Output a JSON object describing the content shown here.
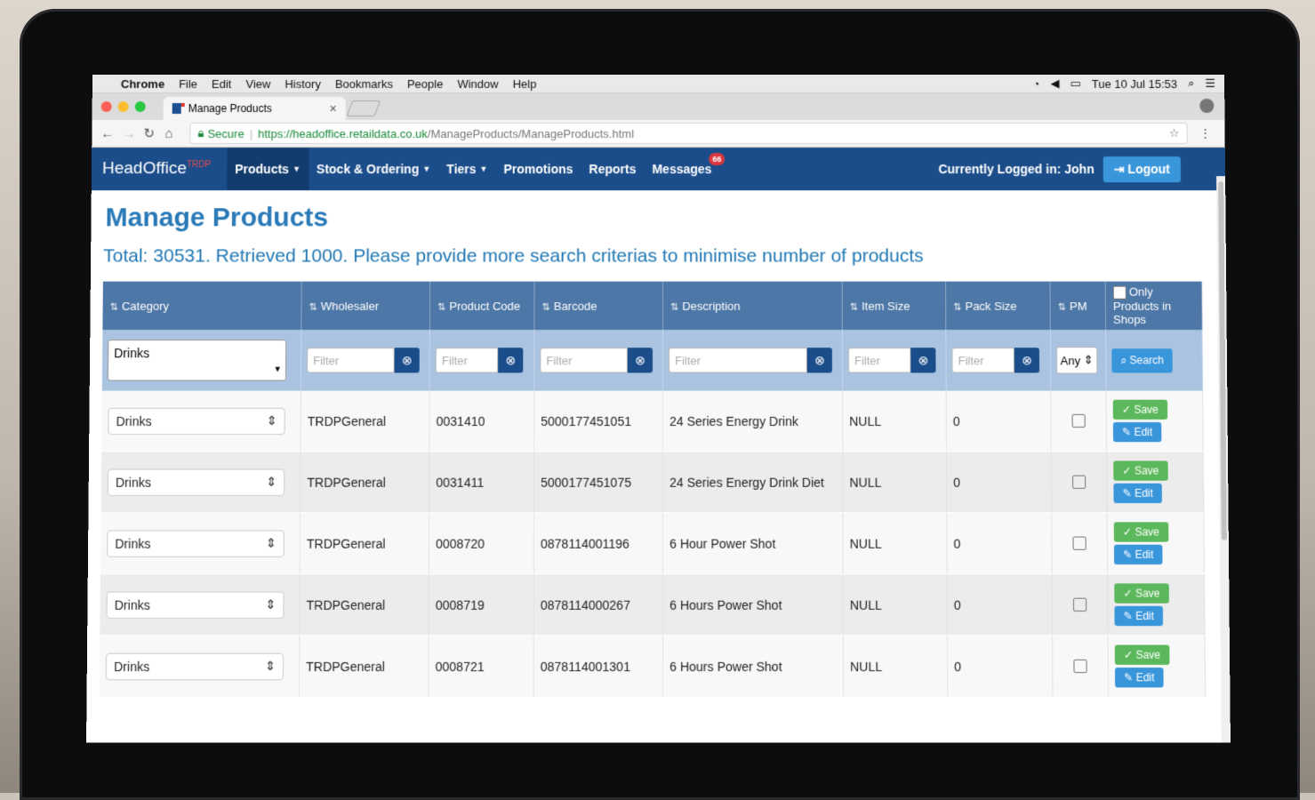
{
  "menubar": {
    "app": "Chrome",
    "items": [
      "File",
      "Edit",
      "View",
      "History",
      "Bookmarks",
      "People",
      "Window",
      "Help"
    ],
    "datetime": "Tue 10 Jul  15:53"
  },
  "browser": {
    "tab_title": "Manage Products",
    "secure_label": "Secure",
    "url_scheme_host": "https://headoffice.retaildata.co.uk",
    "url_path": "/ManageProducts/ManageProducts.html"
  },
  "nav": {
    "brand": "HeadOffice",
    "brand_sup": "TRDP",
    "items": [
      {
        "label": "Products"
      },
      {
        "label": "Stock & Ordering"
      },
      {
        "label": "Tiers"
      },
      {
        "label": "Promotions"
      },
      {
        "label": "Reports"
      },
      {
        "label": "Messages"
      }
    ],
    "messages_badge": "66",
    "logged_in": "Currently Logged in: John",
    "logout": "Logout"
  },
  "page": {
    "title": "Manage Products",
    "total": "Total: 30531. Retrieved 1000. Please provide more search criterias to minimise number of products"
  },
  "table": {
    "headers": [
      "Category",
      "Wholesaler",
      "Product Code",
      "Barcode",
      "Description",
      "Item Size",
      "Pack Size",
      "PM",
      "Only Products in Shops"
    ],
    "filter": {
      "category": "Drinks",
      "placeholder": "Filter",
      "pm": "Any",
      "search": "Search"
    },
    "rows": [
      {
        "category": "Drinks",
        "wholesaler": "TRDPGeneral",
        "code": "0031410",
        "barcode": "5000177451051",
        "description": "24 Series Energy Drink",
        "item_size": "NULL",
        "pack_size": "0"
      },
      {
        "category": "Drinks",
        "wholesaler": "TRDPGeneral",
        "code": "0031411",
        "barcode": "5000177451075",
        "description": "24 Series Energy Drink Diet",
        "item_size": "NULL",
        "pack_size": "0"
      },
      {
        "category": "Drinks",
        "wholesaler": "TRDPGeneral",
        "code": "0008720",
        "barcode": "0878114001196",
        "description": "6 Hour Power Shot",
        "item_size": "NULL",
        "pack_size": "0"
      },
      {
        "category": "Drinks",
        "wholesaler": "TRDPGeneral",
        "code": "0008719",
        "barcode": "0878114000267",
        "description": "6 Hours Power Shot",
        "item_size": "NULL",
        "pack_size": "0"
      },
      {
        "category": "Drinks",
        "wholesaler": "TRDPGeneral",
        "code": "0008721",
        "barcode": "0878114001301",
        "description": "6 Hours Power Shot",
        "item_size": "NULL",
        "pack_size": "0"
      }
    ],
    "save_label": "Save",
    "edit_label": "Edit"
  }
}
